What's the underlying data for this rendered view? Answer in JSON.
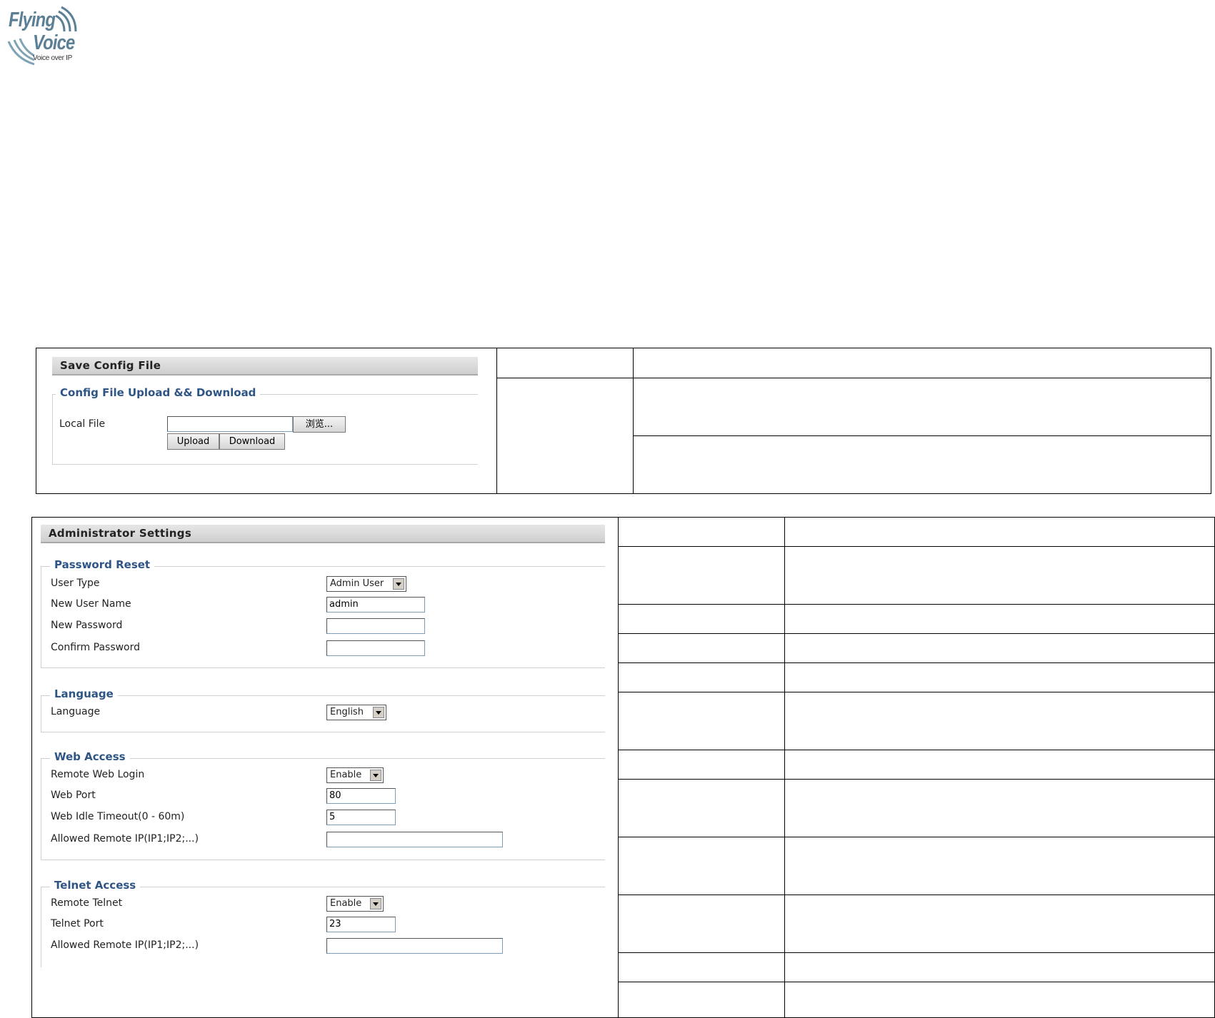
{
  "logo": {
    "line1": "Flying",
    "line2": "Voice",
    "tagline": "Voice over IP"
  },
  "config_panel": {
    "title": "Save Config File",
    "legend": "Config File Upload && Download",
    "local_file_label": "Local File",
    "local_file_value": "",
    "browse_label": "浏览...",
    "upload_label": "Upload",
    "download_label": "Download"
  },
  "admin_panel": {
    "title": "Administrator Settings",
    "password_reset": {
      "legend": "Password Reset",
      "user_type_label": "User Type",
      "user_type_value": "Admin User",
      "new_user_name_label": "New User Name",
      "new_user_name_value": "admin",
      "new_password_label": "New Password",
      "confirm_password_label": "Confirm Password"
    },
    "language": {
      "legend": "Language",
      "language_label": "Language",
      "language_value": "English"
    },
    "web_access": {
      "legend": "Web Access",
      "remote_web_login_label": "Remote Web Login",
      "remote_web_login_value": "Enable",
      "web_port_label": "Web Port",
      "web_port_value": "80",
      "web_idle_timeout_label": "Web Idle Timeout(0 - 60m)",
      "web_idle_timeout_value": "5",
      "allowed_remote_ip_label": "Allowed Remote IP(IP1;IP2;...)",
      "allowed_remote_ip_value": ""
    },
    "telnet_access": {
      "legend": "Telnet Access",
      "remote_telnet_label": "Remote Telnet",
      "remote_telnet_value": "Enable",
      "telnet_port_label": "Telnet Port",
      "telnet_port_value": "23",
      "allowed_remote_ip_label": "Allowed Remote IP(IP1;IP2;...)",
      "allowed_remote_ip_value": ""
    }
  }
}
